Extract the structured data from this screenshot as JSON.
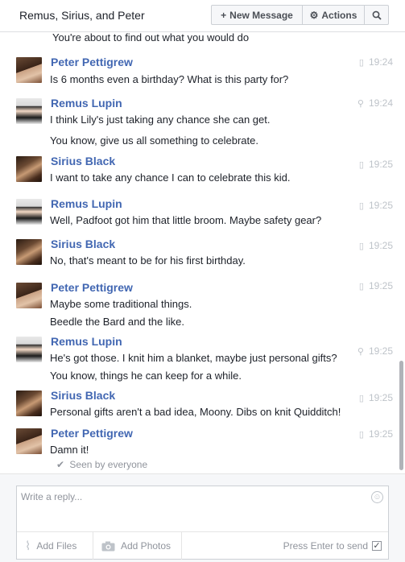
{
  "header": {
    "title": "Remus, Sirius, and Peter",
    "new_message_label": "New Message",
    "actions_label": "Actions",
    "new_message_icon": "plus-icon",
    "actions_icon": "gear-icon",
    "search_icon": "search-icon"
  },
  "thread": {
    "cut_off_text": "You're about to find out what you would do",
    "messages": [
      {
        "sender": "Peter Pettigrew",
        "avatar": "peter",
        "time": "19:24",
        "meta_icon": "phone-icon",
        "lines": [
          "Is 6 months even a birthday? What is this party for?"
        ]
      },
      {
        "sender": "Remus Lupin",
        "avatar": "remus",
        "time": "19:24",
        "meta_icon": "location-pin-icon",
        "lines": [
          "I think Lily's just taking any chance she can get.",
          "You know, give us all something to celebrate."
        ]
      },
      {
        "sender": "Sirius Black",
        "avatar": "sirius",
        "time": "19:25",
        "meta_icon": "phone-icon",
        "lines": [
          "I want to take any chance I can to celebrate this kid."
        ]
      },
      {
        "sender": "Remus Lupin",
        "avatar": "remus",
        "time": "19:25",
        "meta_icon": "phone-icon",
        "lines": [
          "Well, Padfoot got him that little broom. Maybe safety gear?"
        ]
      },
      {
        "sender": "Sirius Black",
        "avatar": "sirius",
        "time": "19:25",
        "meta_icon": "phone-icon",
        "lines": [
          "No, that's meant to be for his first birthday."
        ]
      },
      {
        "sender": "Peter Pettigrew",
        "avatar": "peter",
        "time": "19:25",
        "meta_icon": "phone-icon",
        "lines": [
          "Maybe some traditional things.",
          "Beedle the Bard and the like."
        ]
      },
      {
        "sender": "Remus Lupin",
        "avatar": "remus",
        "time": "19:25",
        "meta_icon": "location-pin-icon",
        "lines": [
          "He's got those. I knit him a blanket, maybe just personal gifts?",
          "You know, things he can keep for a while."
        ]
      },
      {
        "sender": "Sirius Black",
        "avatar": "sirius",
        "time": "19:25",
        "meta_icon": "phone-icon",
        "lines": [
          "Personal gifts aren't a bad idea, Moony. Dibs on knit Quidditch!"
        ]
      },
      {
        "sender": "Peter Pettigrew",
        "avatar": "peter",
        "time": "19:25",
        "meta_icon": "phone-icon",
        "lines": [
          "Damn it!"
        ]
      }
    ],
    "seen_text": "Seen by everyone",
    "seen_icon": "check-icon"
  },
  "composer": {
    "placeholder": "Write a reply...",
    "add_files_label": "Add Files",
    "add_photos_label": "Add Photos",
    "press_enter_label": "Press Enter to send",
    "press_enter_checked": true,
    "emoji_icon": "smiley-icon",
    "files_icon": "paperclip-icon",
    "photos_icon": "camera-icon"
  }
}
